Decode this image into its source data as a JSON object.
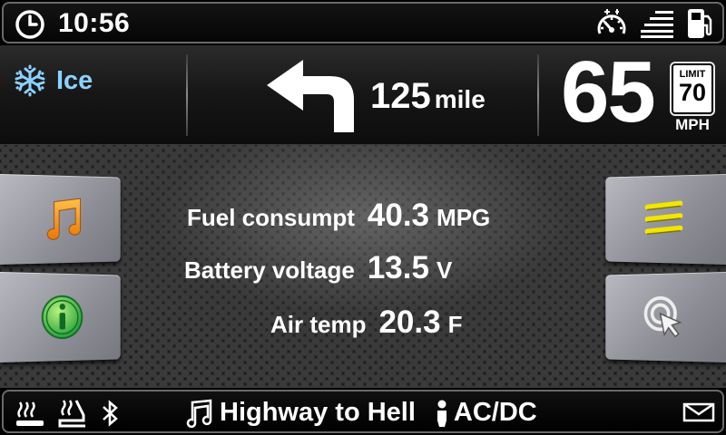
{
  "status_bar": {
    "time": "10:56",
    "icons": [
      "clock-icon",
      "speedometer-icon",
      "headlight-icon",
      "fuel-pump-icon"
    ]
  },
  "navigation": {
    "road_condition": {
      "icon": "snowflake-icon",
      "label": "Ice",
      "color": "#8cd2ff"
    },
    "turn_direction": "left",
    "distance_value": "125",
    "distance_unit": "mile",
    "current_speed": "65",
    "speed_limit_label": "LIMIT",
    "speed_limit_value": "70",
    "speed_unit": "MPH"
  },
  "stats": [
    {
      "label": "Fuel consumpt",
      "value": "40.3",
      "unit": "MPG"
    },
    {
      "label": "Battery voltage",
      "value": "13.5",
      "unit": "V"
    },
    {
      "label": "Air temp",
      "value": "20.3",
      "unit": "F"
    }
  ],
  "side_buttons": {
    "left": [
      {
        "name": "music-button",
        "icon": "music-note-icon",
        "color": "#f7941d"
      },
      {
        "name": "info-button",
        "icon": "info-icon",
        "color": "#3cb44a"
      }
    ],
    "right": [
      {
        "name": "menu-button",
        "icon": "menu-lines-icon",
        "color": "#f2e600"
      },
      {
        "name": "touch-button",
        "icon": "touch-pointer-icon",
        "color": "#e6e6e6"
      }
    ]
  },
  "bottom_bar": {
    "icons": [
      "seat-heater-icon",
      "seat-heater-2-icon",
      "bluetooth-icon",
      "mail-icon"
    ],
    "song": "Highway to Hell",
    "artist": "AC/DC"
  }
}
